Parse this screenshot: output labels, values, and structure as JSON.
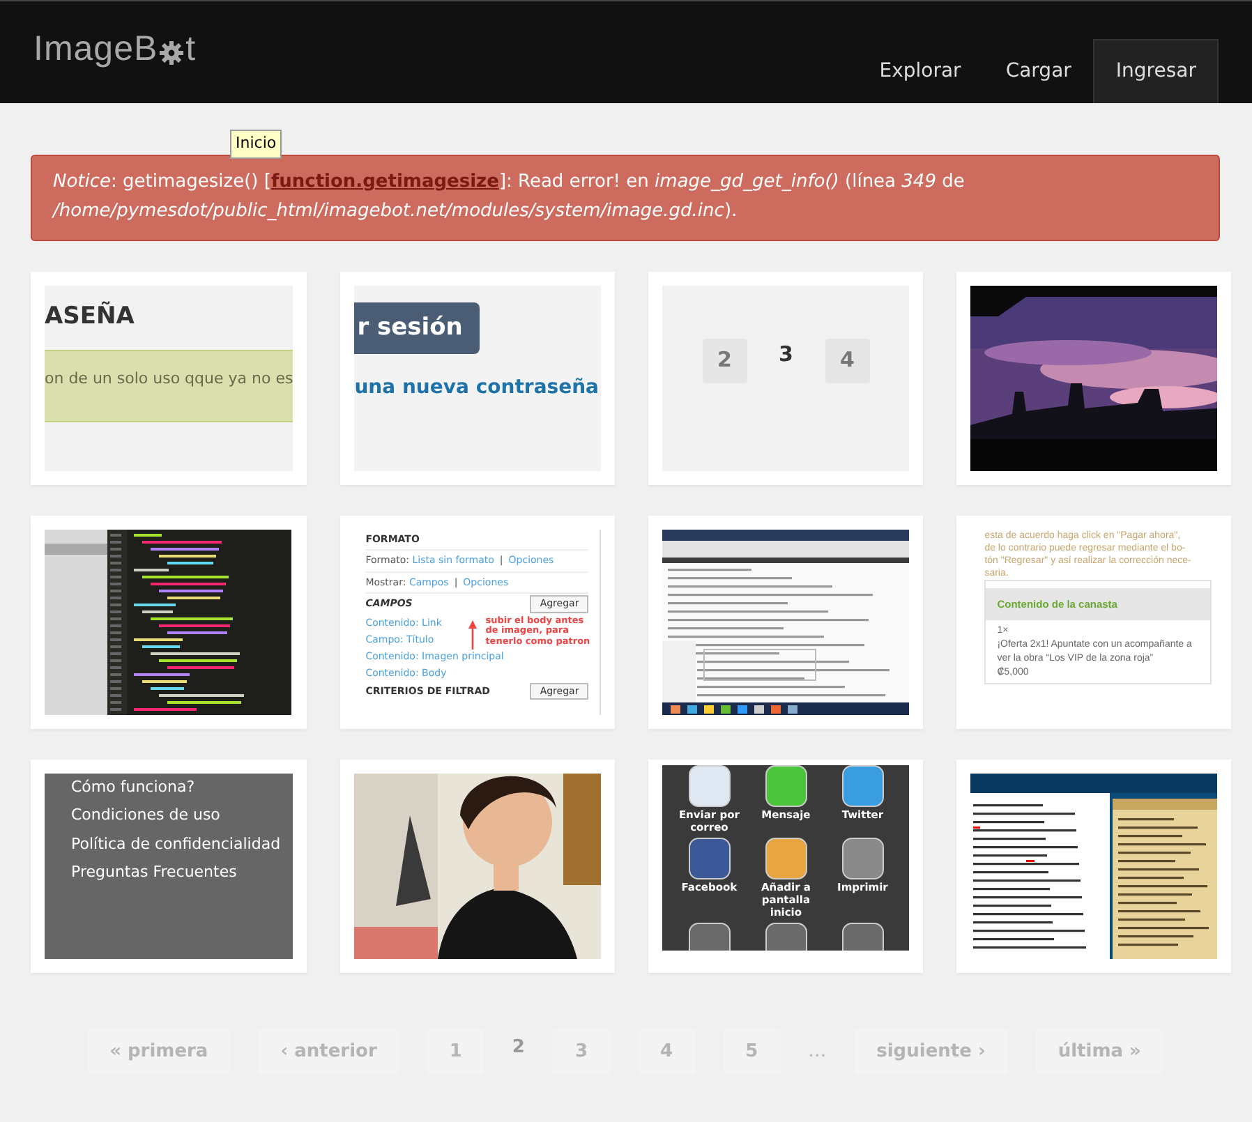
{
  "header": {
    "logo_before": "ImageB",
    "logo_after": "t",
    "nav": [
      {
        "label": "Explorar",
        "selected": false
      },
      {
        "label": "Cargar",
        "selected": false
      },
      {
        "label": "Ingresar",
        "selected": true
      }
    ]
  },
  "tooltip": "Inicio",
  "notice": {
    "before": "*Notice*: getimagesize() [",
    "link": "function.getimagesize",
    "after": "]: Read error! en *image_gd_get_info()* (línea *349* de */home/pymesdot/public_html/imagebot.net/modules/system/image.gd.inc*)."
  },
  "thumbnails": [
    {
      "kind": "password",
      "heading": "ASEÑA",
      "message": "on de un solo uso qque ya no es"
    },
    {
      "kind": "login",
      "button": "r sesión",
      "link": "una nueva contraseña"
    },
    {
      "kind": "pager",
      "items": [
        {
          "label": "2",
          "selected": false
        },
        {
          "label": "3",
          "selected": true
        },
        {
          "label": "4",
          "selected": false
        }
      ]
    },
    {
      "kind": "picture"
    },
    {
      "kind": "code"
    },
    {
      "kind": "form",
      "heading": "FORMATO",
      "rows": [
        {
          "label": "Formato:",
          "links": [
            "Lista sin formato",
            "Opciones"
          ],
          "separator": "|"
        },
        {
          "label": "Mostrar:",
          "links": [
            "Campos",
            "Opciones"
          ],
          "separator": "|"
        }
      ],
      "section": "CAMPOS",
      "button": "Agregar",
      "fields": [
        "Contenido: Link",
        "Campo: Título",
        "Contenido: Imagen principal",
        "Contenido: Body"
      ],
      "note": "subir el body antes de imagen, para tenerlo como patron",
      "section2": "CRITERIOS DE FILTRAD",
      "button2": "Agregar"
    },
    {
      "kind": "browser"
    },
    {
      "kind": "cart",
      "lines": [
        "esta de acuerdo haga click en \"Pagar ahora\",",
        "de lo contrario puede regresar mediante el bo-",
        "tón \"Regresar\" y así realizar la corrección nece-",
        "saria."
      ],
      "title": "Contenido de la canasta",
      "qty": "1×",
      "product": "¡Oferta 2x1! Apuntate con un acompañante a ver la obra “Los VIP de la zona roja”",
      "price": "₡5,000"
    },
    {
      "kind": "menu",
      "links": [
        "Cómo funciona?",
        "Condiciones de uso",
        "Política de confidencialidad",
        "Preguntas Frecuentes"
      ]
    },
    {
      "kind": "picture"
    },
    {
      "kind": "share",
      "apps": [
        {
          "label": "Enviar por correo",
          "color": "#dfe8f3"
        },
        {
          "label": "Mensaje",
          "color": "#4cc43c"
        },
        {
          "label": "Twitter",
          "color": "#3a9de0"
        },
        {
          "label": "Facebook",
          "color": "#3b5998"
        },
        {
          "label": "Añadir a pantalla inicio",
          "color": "#e9a640"
        },
        {
          "label": "Imprimir",
          "color": "#8a8a8a"
        },
        {
          "color": "#6a6a6a"
        },
        {
          "color": "#6a6a6a"
        },
        {
          "color": "#6a6a6a"
        }
      ]
    },
    {
      "kind": "journal"
    }
  ],
  "pagination": [
    {
      "label": "« primera",
      "kind": "link",
      "selected": false
    },
    {
      "label": "‹ anterior",
      "kind": "link",
      "selected": false
    },
    {
      "label": "1",
      "kind": "link",
      "selected": false
    },
    {
      "label": "2",
      "kind": "link",
      "selected": true
    },
    {
      "label": "3",
      "kind": "link",
      "selected": false
    },
    {
      "label": "4",
      "kind": "link",
      "selected": false
    },
    {
      "label": "5",
      "kind": "link",
      "selected": false
    },
    {
      "label": "…",
      "kind": "ellipsis",
      "selected": false
    },
    {
      "label": "siguiente ›",
      "kind": "link",
      "selected": false
    },
    {
      "label": "última »",
      "kind": "link",
      "selected": false
    }
  ]
}
